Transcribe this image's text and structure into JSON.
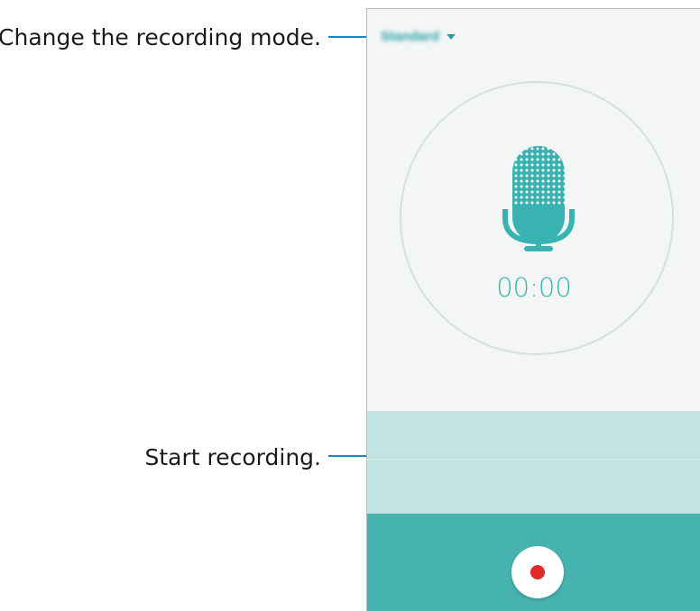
{
  "callouts": {
    "mode": "Change the recording mode.",
    "record": "Start recording."
  },
  "recorder": {
    "mode_label": "Standard",
    "mode_icon": "chevron-down-icon",
    "mic_icon": "microphone-icon",
    "timer": "00:00",
    "record_icon": "record-icon"
  },
  "colors": {
    "accent": "#39b3b2",
    "callout_line": "#1f86b8",
    "wave_area": "#c1e4e3",
    "control_bar": "#47b3b0",
    "record_dot": "#e02a2a"
  }
}
